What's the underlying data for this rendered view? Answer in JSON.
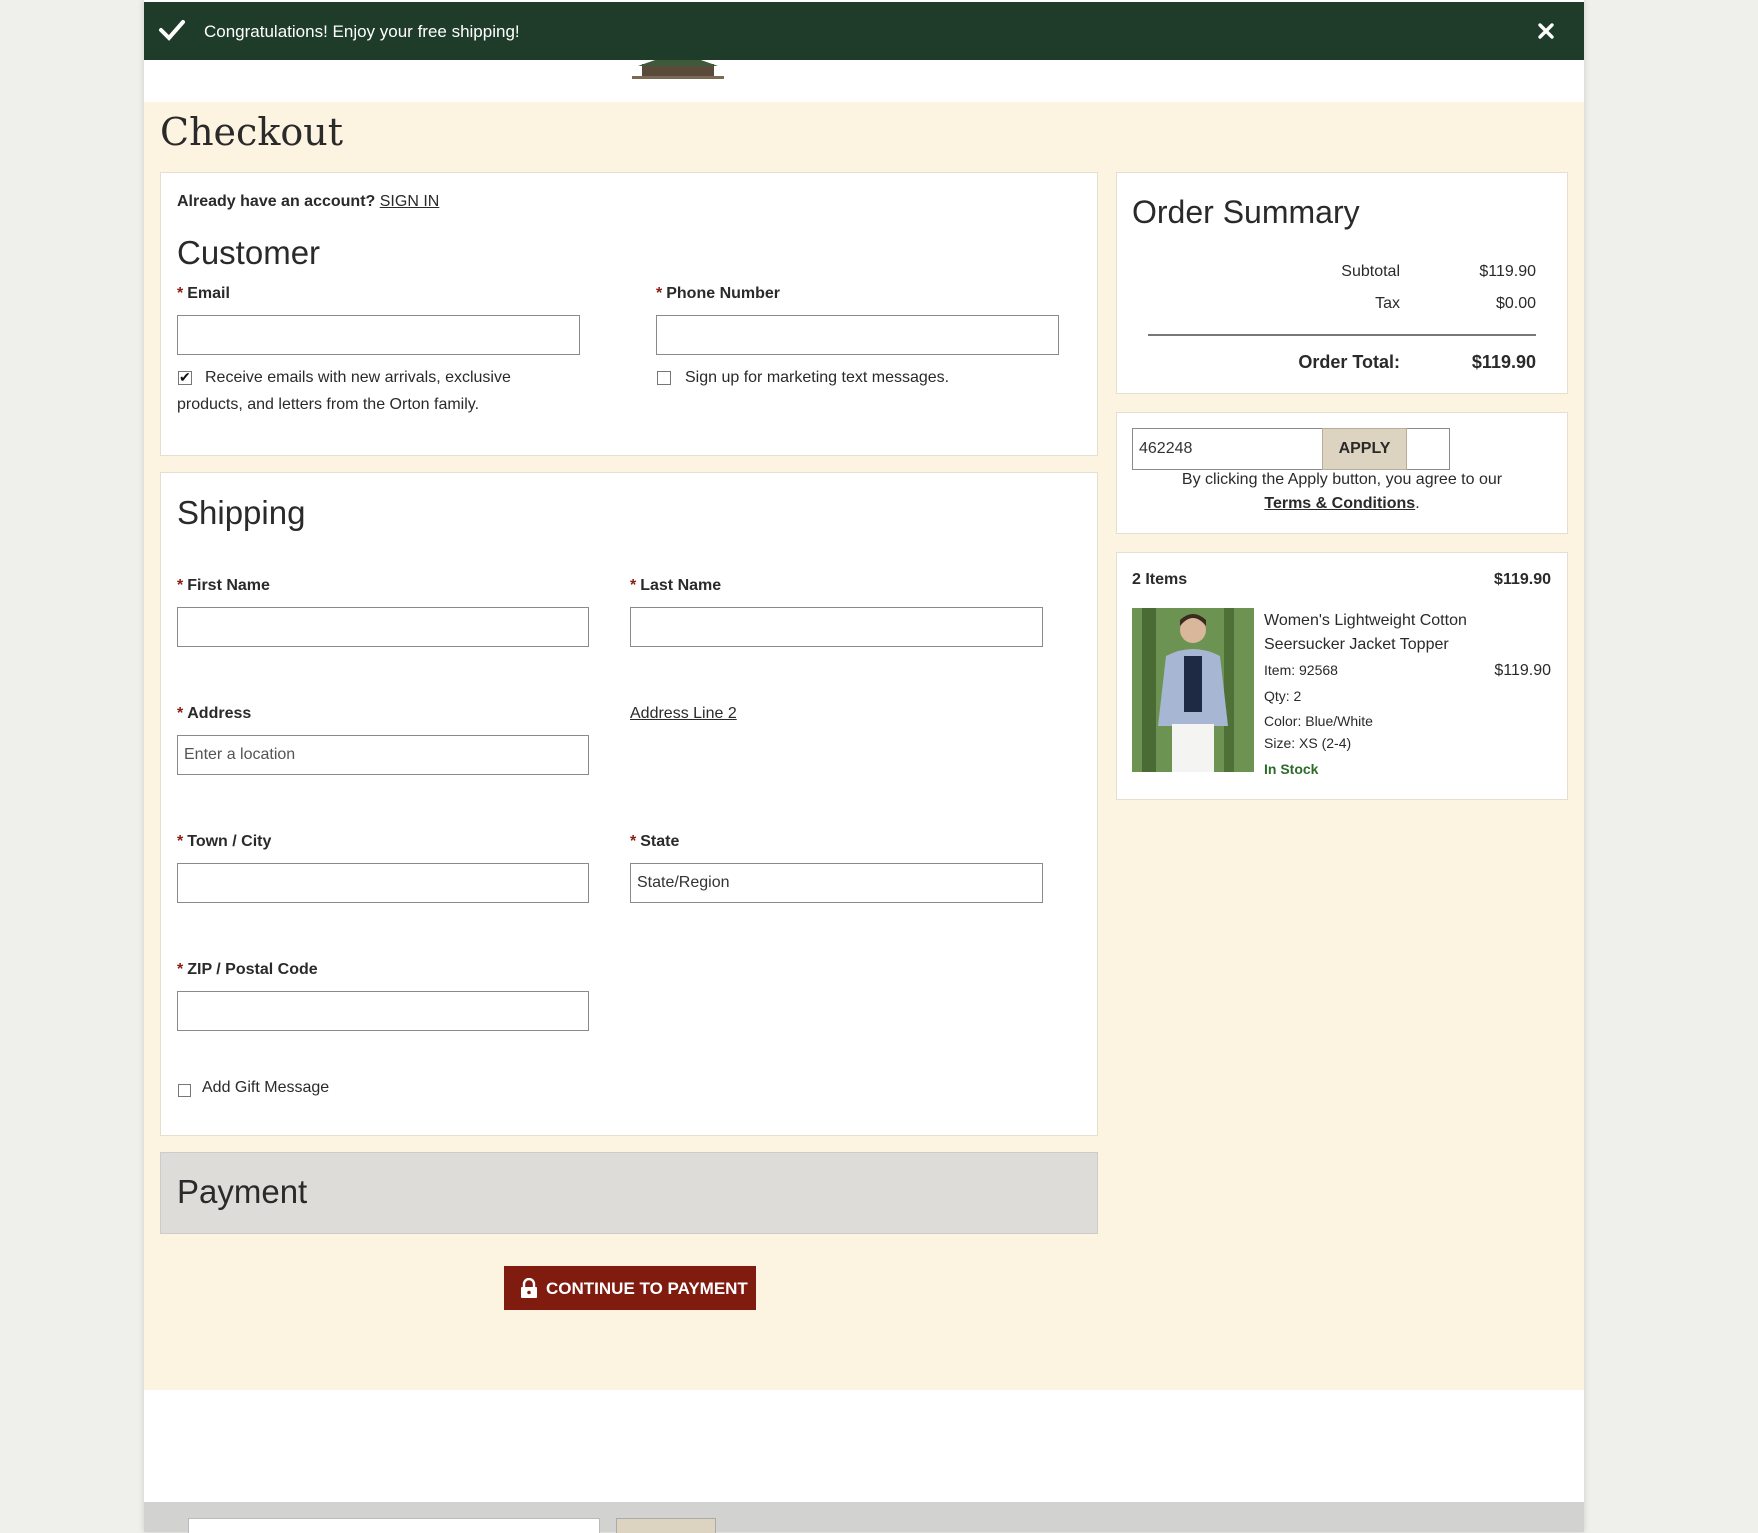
{
  "notice": {
    "message": "Congratulations! Enjoy your free shipping!"
  },
  "page": {
    "title": "Checkout"
  },
  "account": {
    "prompt": "Already have an account?",
    "sign_in": "SIGN IN"
  },
  "customer": {
    "heading": "Customer",
    "email_label": "Email",
    "phone_label": "Phone Number",
    "email_optin_line1": "Receive emails with new arrivals, exclusive",
    "email_optin_line2": "products, and letters from the Orton family.",
    "email_optin_checked": true,
    "sms_optin": "Sign up for marketing text messages.",
    "sms_optin_checked": false
  },
  "shipping": {
    "heading": "Shipping",
    "first_name_label": "First Name",
    "last_name_label": "Last Name",
    "address_label": "Address",
    "address_placeholder": "Enter a location",
    "address_line2": "Address Line 2",
    "city_label": "Town / City",
    "state_label": "State",
    "state_value": "State/Region",
    "zip_label": "ZIP / Postal Code",
    "gift_message": "Add Gift Message",
    "gift_checked": false
  },
  "payment": {
    "heading": "Payment",
    "continue_button": "CONTINUE TO PAYMENT"
  },
  "summary": {
    "heading": "Order Summary",
    "subtotal_label": "Subtotal",
    "subtotal_value": "$119.90",
    "tax_label": "Tax",
    "tax_value": "$0.00",
    "total_label": "Order Total:",
    "total_value": "$119.90"
  },
  "promo": {
    "code_value": "462248",
    "apply_button": "APPLY",
    "agree_text": "By clicking the Apply button, you agree to our",
    "terms_link": "Terms & Conditions"
  },
  "cart": {
    "count_label": "2 Items",
    "total": "$119.90",
    "item": {
      "name_line1": "Women's Lightweight Cotton",
      "name_line2": "Seersucker Jacket Topper",
      "item_no": "Item: 92568",
      "qty": "Qty: 2",
      "color": "Color: Blue/White",
      "size": "Size: XS (2-4)",
      "stock": "In Stock",
      "price": "$119.90"
    }
  },
  "colors": {
    "notice_bg": "#1f3b2a",
    "accent": "#801b10",
    "page_bg": "#fcf4e0",
    "in_stock": "#2e6b2a"
  }
}
